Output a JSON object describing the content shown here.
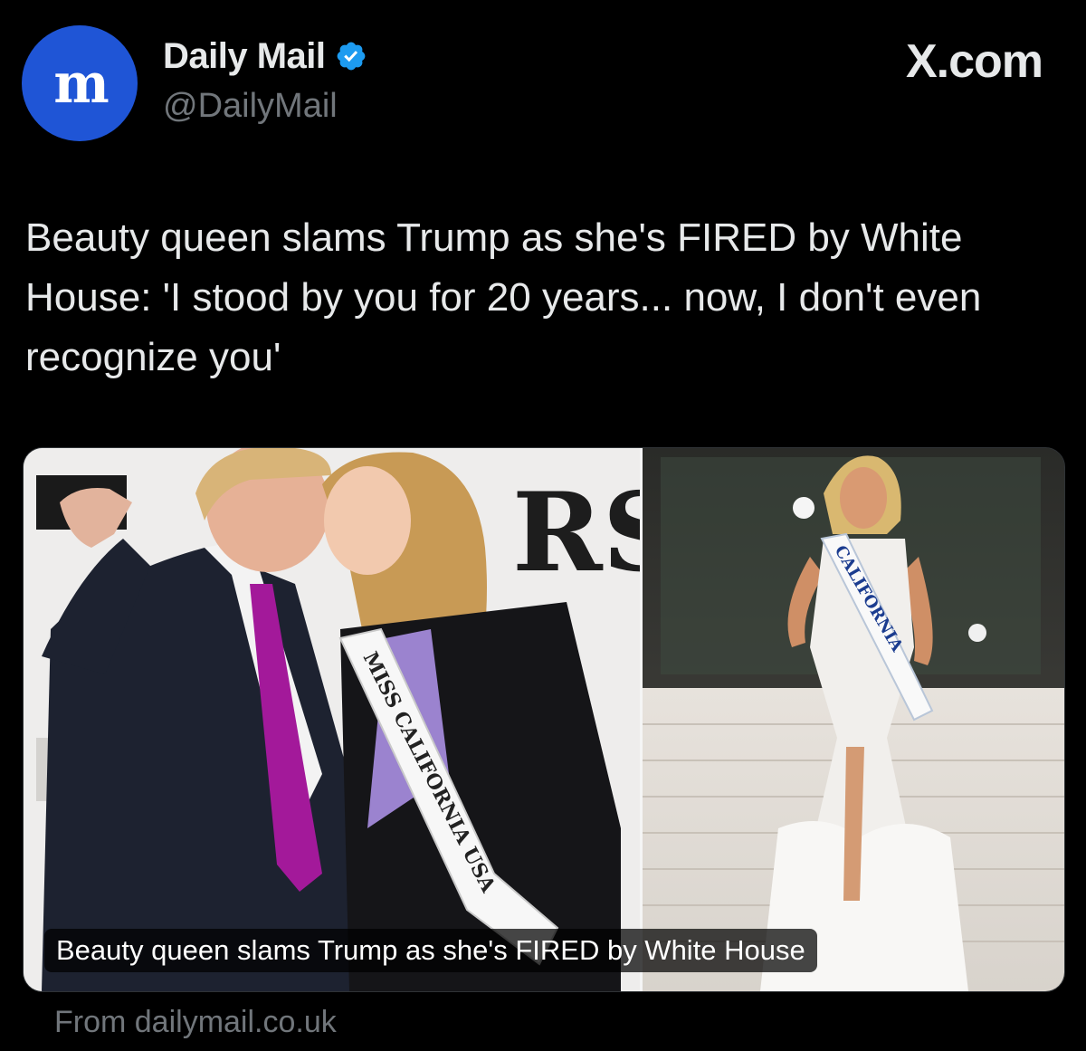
{
  "author": {
    "display_name": "Daily Mail",
    "handle": "@DailyMail",
    "avatar_icon": "daily-mail-logo",
    "verified_icon": "verified-badge-icon",
    "verified_color": "#1d9bf0",
    "avatar_color": "#1f55d6"
  },
  "brand": {
    "label": "X.com"
  },
  "tweet": {
    "text": "Beauty queen slams Trump as she's FIRED by White House: 'I stood by you for 20 years... now, I don't even recognize you'"
  },
  "card": {
    "caption": "Beauty queen slams Trump as she's FIRED by White House",
    "source": "From dailymail.co.uk",
    "left_image": {
      "sash_text": "MISS CALIFORNIA USA",
      "backdrop_letters": "RS"
    },
    "right_image": {
      "sash_text": "CALIFORNIA"
    }
  }
}
